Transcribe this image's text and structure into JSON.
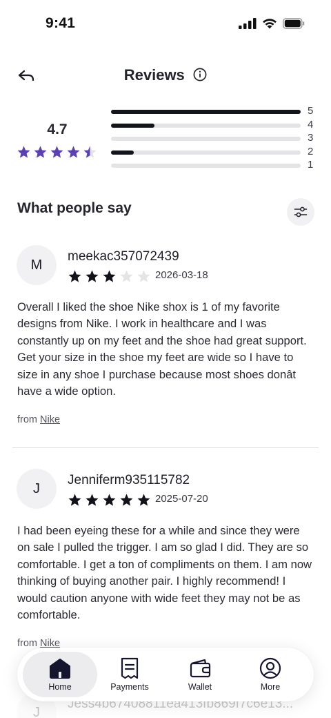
{
  "status_bar": {
    "time": "9:41"
  },
  "header": {
    "title": "Reviews"
  },
  "rating": {
    "average": "4.7",
    "stars_filled": 4.5,
    "distribution": [
      {
        "label": "5",
        "fraction": 1.0
      },
      {
        "label": "4",
        "fraction": 0.23
      },
      {
        "label": "3",
        "fraction": 0.0
      },
      {
        "label": "2",
        "fraction": 0.12
      },
      {
        "label": "1",
        "fraction": 0.0
      }
    ]
  },
  "section": {
    "title": "What people say"
  },
  "reviews": [
    {
      "initial": "M",
      "name": "meekac357072439",
      "stars": 3,
      "date": "2026-03-18",
      "text": "Overall I liked the shoe Nike shox is 1 of my favorite designs from Nike. I work in healthcare and I was constantly up on my feet and the shoe had great support. Get your size in the shoe my feet are wide so I have to size in any shoe I purchase because most shoes donât have a wide option.",
      "from_label": "from",
      "source": "Nike"
    },
    {
      "initial": "J",
      "name": "Jenniferm935115782",
      "stars": 5,
      "date": "2025-07-20",
      "text": "I had been eyeing these for a while and since they were on sale I pulled the trigger. I am so glad I did. They are so comfortable. I get a ton of compliments on them. I am now thinking of buying another pair. I highly recommend! I would caution anyone with wide feet they may not be as comfortable.",
      "from_label": "from",
      "source": "Nike"
    },
    {
      "initial": "J",
      "name": "Jess4b67408811ea413fb869f7c6e13..."
    }
  ],
  "nav": {
    "items": [
      {
        "label": "Home",
        "icon": "home-icon",
        "active": true
      },
      {
        "label": "Payments",
        "icon": "receipt-icon",
        "active": false
      },
      {
        "label": "Wallet",
        "icon": "wallet-icon",
        "active": false
      },
      {
        "label": "More",
        "icon": "user-circle-icon",
        "active": false
      }
    ]
  },
  "colors": {
    "accent_star": "#5b3fb5",
    "review_star": "#12121a",
    "empty_star": "#e4e4e7",
    "bar_fill": "#14141c",
    "bar_track": "#e4e4e7"
  }
}
